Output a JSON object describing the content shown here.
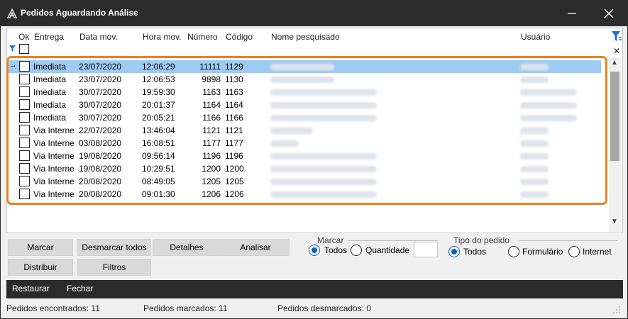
{
  "window": {
    "title": "Pedidos Aguardando Análise",
    "minimize": "—",
    "close": "✕"
  },
  "columns": [
    "Ok",
    "Entrega",
    "Data mov.",
    "Hora mov.",
    "Número",
    "Código",
    "Nome pesquisado",
    "Usuário"
  ],
  "rows": [
    {
      "entrega": "Imediata",
      "data": "23/07/2020",
      "hora": "12:06:29",
      "numero": "11111",
      "codigo": "1129",
      "selected": true
    },
    {
      "entrega": "Imediata",
      "data": "23/07/2020",
      "hora": "12:06:53",
      "numero": "9898",
      "codigo": "1130"
    },
    {
      "entrega": "Imediata",
      "data": "30/07/2020",
      "hora": "19:59:30",
      "numero": "1163",
      "codigo": "1163"
    },
    {
      "entrega": "Imediata",
      "data": "30/07/2020",
      "hora": "20:01:37",
      "numero": "1164",
      "codigo": "1164"
    },
    {
      "entrega": "Imediata",
      "data": "30/07/2020",
      "hora": "20:05:21",
      "numero": "1166",
      "codigo": "1166"
    },
    {
      "entrega": "Via Interne",
      "data": "22/07/2020",
      "hora": "13:46:04",
      "numero": "1121",
      "codigo": "1121"
    },
    {
      "entrega": "Via Interne",
      "data": "03/08/2020",
      "hora": "16:08:51",
      "numero": "1177",
      "codigo": "1177"
    },
    {
      "entrega": "Via Interne",
      "data": "19/08/2020",
      "hora": "09:56:14",
      "numero": "1196",
      "codigo": "1196"
    },
    {
      "entrega": "Via Interne",
      "data": "19/08/2020",
      "hora": "10:29:51",
      "numero": "1200",
      "codigo": "1200"
    },
    {
      "entrega": "Via Interne",
      "data": "20/08/2020",
      "hora": "08:49:05",
      "numero": "1205",
      "codigo": "1205"
    },
    {
      "entrega": "Via Interne",
      "data": "20/08/2020",
      "hora": "09:01:30",
      "numero": "1206",
      "codigo": "1206"
    }
  ],
  "buttons": {
    "marcar": "Marcar",
    "desmarcar_todos": "Desmarcar todos",
    "detalhes": "Detalhes",
    "analisar": "Analisar",
    "distribuir": "Distribuir",
    "filtros": "Filtros"
  },
  "marcar_group": {
    "label": "Marcar",
    "todos": "Todos",
    "quantidade": "Quantidade",
    "quantidade_value": ""
  },
  "tipo_group": {
    "label": "Tipo do pedido",
    "todos": "Todos",
    "formulario": "Formulário",
    "internet": "Internet"
  },
  "footer": {
    "restaurar": "Restaurar",
    "fechar": "Fechar"
  },
  "status": {
    "encontrados": "Pedidos encontrados: 11",
    "marcados": "Pedidos marcados: 11",
    "desmarcados": "Pedidos desmarcados: 0"
  },
  "colors": {
    "highlight": "#e8821e",
    "selected_row": "#9dcbf3",
    "accent": "#0a63c4",
    "bar": "#2b2b2b"
  }
}
